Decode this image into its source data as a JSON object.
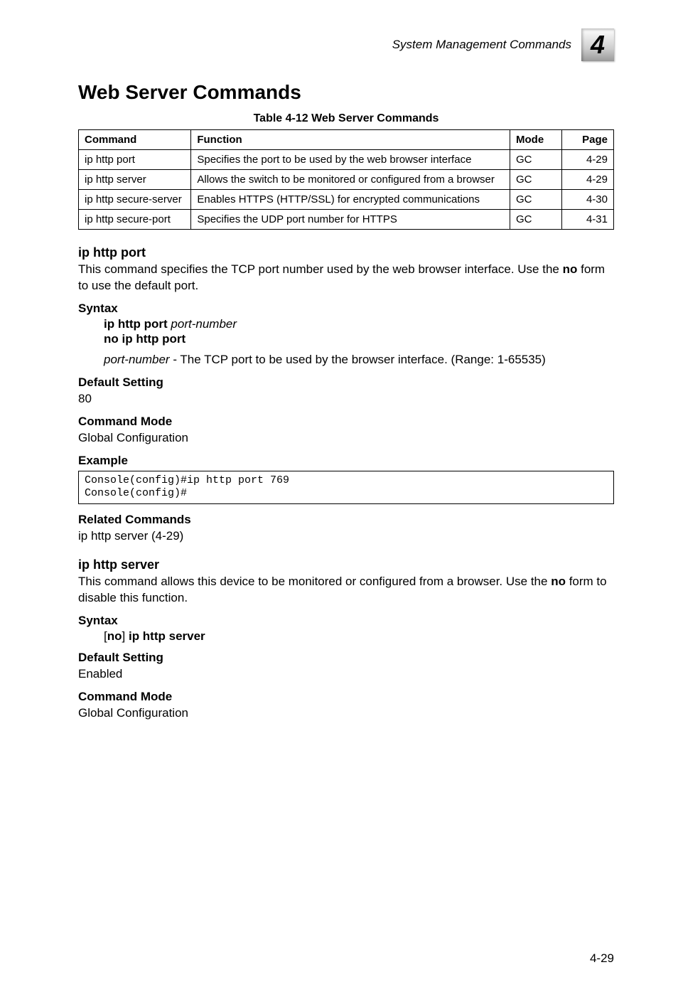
{
  "header": {
    "label": "System Management Commands",
    "chapter": "4"
  },
  "section_title": "Web Server Commands",
  "table": {
    "caption": "Table 4-12   Web Server Commands",
    "headers": [
      "Command",
      "Function",
      "Mode",
      "Page"
    ],
    "rows": [
      {
        "command": "ip http port",
        "function": "Specifies the port to be used by the web browser interface",
        "mode": "GC",
        "page": "4-29"
      },
      {
        "command": "ip http server",
        "function": "Allows the switch to be monitored or configured from a browser",
        "mode": "GC",
        "page": "4-29"
      },
      {
        "command": "ip http secure-server",
        "function": "Enables HTTPS (HTTP/SSL) for encrypted communications",
        "mode": "GC",
        "page": "4-30"
      },
      {
        "command": "ip http secure-port",
        "function": "Specifies the UDP port number for HTTPS",
        "mode": "GC",
        "page": "4-31"
      }
    ]
  },
  "cmd1": {
    "name": "ip http port",
    "desc_pre": "This command specifies the TCP port number used by the web browser interface. Use the ",
    "desc_bold": "no",
    "desc_post": " form to use the default port.",
    "syntax_label": "Syntax",
    "syntax_line1_bold": "ip http port ",
    "syntax_line1_italic": "port-number",
    "syntax_line2": "no ip http port",
    "param_italic": "port-number",
    "param_rest": " - The TCP port to be used by the browser interface. (Range: 1-65535)",
    "default_label": "Default Setting",
    "default_value": "80",
    "mode_label": "Command Mode",
    "mode_value": "Global Configuration",
    "example_label": "Example",
    "example_code": "Console(config)#ip http port 769\nConsole(config)#",
    "related_label": "Related Commands",
    "related_value": "ip http server (4-29)"
  },
  "cmd2": {
    "name": "ip http server",
    "desc_pre": "This command allows this device to be monitored or configured from a browser. Use the ",
    "desc_bold": "no",
    "desc_post": " form to disable this function.",
    "syntax_label": "Syntax",
    "syntax_open": "[",
    "syntax_no": "no",
    "syntax_close": "] ",
    "syntax_cmd": "ip http server",
    "default_label": "Default Setting",
    "default_value": "Enabled",
    "mode_label": "Command Mode",
    "mode_value": "Global Configuration"
  },
  "page_number": "4-29"
}
